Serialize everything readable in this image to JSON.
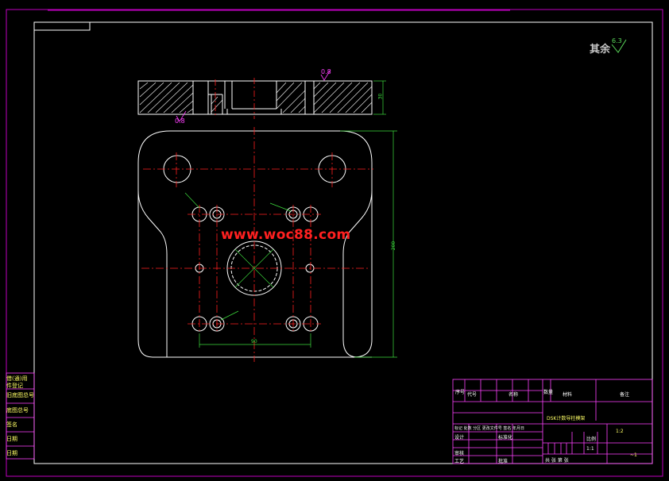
{
  "watermark": "www.woc88.com",
  "roughness": {
    "label": "其余",
    "value": "6.3"
  },
  "symbols": {
    "top": "0.8",
    "left": "0.8"
  },
  "dimensions": {
    "height": "200",
    "bottom_span": "90",
    "top_thickness": "30"
  },
  "side_panel": [
    "借(通)用",
    "件登记",
    "旧底图总号",
    "底图总号",
    "签名",
    "日期",
    "日期"
  ],
  "title_block": {
    "header": [
      "序号",
      "代号",
      "名称",
      "数量",
      "材料",
      "备注"
    ],
    "drawing_name": "DSK计数导柱模架",
    "scale_label": "比例",
    "quantity": "1:1",
    "weight": "1:2",
    "sheet": "共 张 第 张",
    "code": "~1",
    "rows": [
      "设计",
      "审核",
      "工艺",
      "标准化",
      "批准"
    ],
    "rev_header": "标记 处数 分区 更改文件号 签名 年月日"
  }
}
